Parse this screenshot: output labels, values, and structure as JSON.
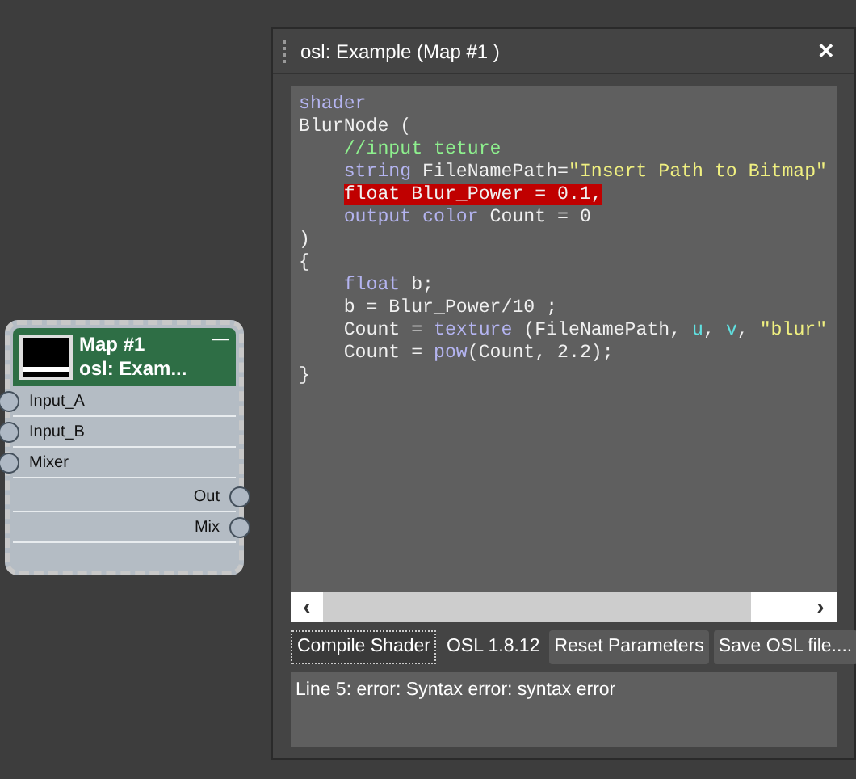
{
  "node": {
    "title": "Map #1",
    "subtitle": "osl: Exam...",
    "collapse": "—",
    "inputs": [
      {
        "label": "Input_A"
      },
      {
        "label": "Input_B"
      },
      {
        "label": "Mixer"
      }
    ],
    "outputs": [
      {
        "label": "Out"
      },
      {
        "label": "Mix"
      }
    ]
  },
  "editor": {
    "title": "osl: Example (Map #1 )",
    "close": "✕",
    "code_lines": [
      {
        "error": false,
        "tokens": [
          {
            "kind": "keyword",
            "text": "shader"
          }
        ]
      },
      {
        "error": false,
        "tokens": [
          {
            "kind": "plain",
            "text": "BlurNode ("
          }
        ]
      },
      {
        "error": false,
        "tokens": [
          {
            "kind": "comment",
            "text": "    //input teture"
          }
        ]
      },
      {
        "error": false,
        "tokens": [
          {
            "kind": "keyword",
            "text": "    string"
          },
          {
            "kind": "plain",
            "text": " FileNamePath="
          },
          {
            "kind": "string",
            "text": "\"Insert Path to Bitmap\""
          }
        ]
      },
      {
        "error": true,
        "tokens": [
          {
            "text": "    float Blur_Power = 0.1,"
          }
        ]
      },
      {
        "error": false,
        "tokens": [
          {
            "kind": "keyword",
            "text": "    output color"
          },
          {
            "kind": "plain",
            "text": " Count = 0"
          }
        ]
      },
      {
        "error": false,
        "tokens": [
          {
            "kind": "plain",
            "text": ")"
          }
        ]
      },
      {
        "error": false,
        "tokens": [
          {
            "kind": "plain",
            "text": "{"
          }
        ]
      },
      {
        "error": false,
        "tokens": [
          {
            "kind": "keyword",
            "text": "    float"
          },
          {
            "kind": "plain",
            "text": " b;"
          }
        ]
      },
      {
        "error": false,
        "tokens": [
          {
            "kind": "plain",
            "text": "    b = Blur_Power/10 ;"
          }
        ]
      },
      {
        "error": false,
        "tokens": [
          {
            "kind": "plain",
            "text": "    Count = "
          },
          {
            "kind": "keyword",
            "text": "texture"
          },
          {
            "kind": "plain",
            "text": " (FileNamePath, "
          },
          {
            "kind": "global",
            "text": "u"
          },
          {
            "kind": "plain",
            "text": ", "
          },
          {
            "kind": "global",
            "text": "v"
          },
          {
            "kind": "plain",
            "text": ", "
          },
          {
            "kind": "string",
            "text": "\"blur\""
          }
        ]
      },
      {
        "error": false,
        "tokens": [
          {
            "kind": "plain",
            "text": "    Count = "
          },
          {
            "kind": "keyword",
            "text": "pow"
          },
          {
            "kind": "plain",
            "text": "(Count, 2.2);"
          }
        ]
      },
      {
        "error": false,
        "tokens": [
          {
            "kind": "plain",
            "text": "}"
          }
        ]
      }
    ],
    "scroll_left": "‹",
    "scroll_right": "›",
    "buttons": [
      {
        "kind": "focused",
        "label": "Compile Shader"
      },
      {
        "kind": "label",
        "label": "OSL 1.8.12"
      },
      {
        "kind": "button",
        "label": "Reset Parameters"
      },
      {
        "kind": "button",
        "label": "Save OSL file...."
      }
    ],
    "message": "Line 5: error: Syntax error: syntax error"
  }
}
